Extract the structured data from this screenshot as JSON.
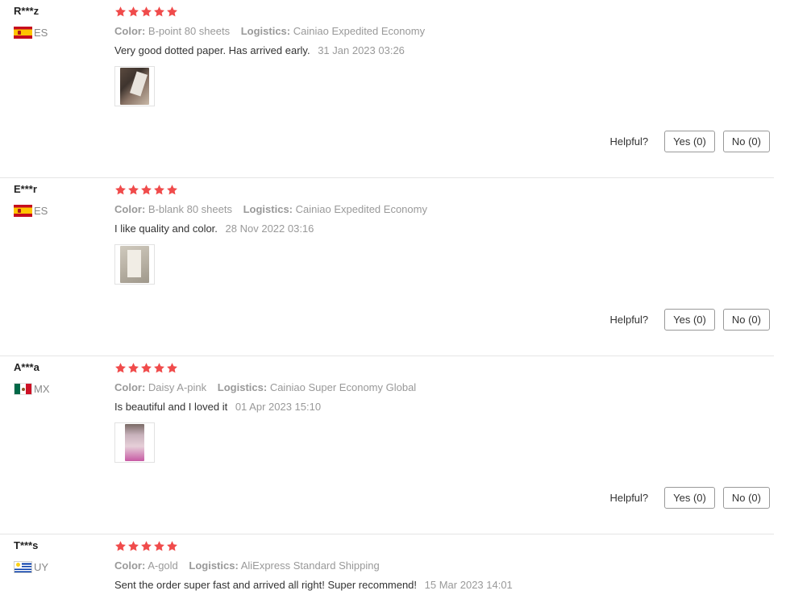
{
  "labels": {
    "color": "Color:",
    "logistics": "Logistics:",
    "helpful": "Helpful?"
  },
  "colors": {
    "star": "#f04b4b"
  },
  "reviews": [
    {
      "user": "R***z",
      "country": "ES",
      "flag_icon": "spain-flag-icon",
      "stars": 5,
      "color": "B-point 80 sheets",
      "logistics": "Cainiao Expedited Economy",
      "text": "Very good dotted paper. Has arrived early.",
      "date": "31 Jan 2023 03:26",
      "yes": "Yes (0)",
      "no": "No (0)"
    },
    {
      "user": "E***r",
      "country": "ES",
      "flag_icon": "spain-flag-icon",
      "stars": 5,
      "color": "B-blank 80 sheets",
      "logistics": "Cainiao Expedited Economy",
      "text": "I like quality and color.",
      "date": "28 Nov 2022 03:16",
      "yes": "Yes (0)",
      "no": "No (0)"
    },
    {
      "user": "A***a",
      "country": "MX",
      "flag_icon": "mexico-flag-icon",
      "stars": 5,
      "color": "Daisy A-pink",
      "logistics": "Cainiao Super Economy Global",
      "text": "Is beautiful and I loved it",
      "date": "01 Apr 2023 15:10",
      "yes": "Yes (0)",
      "no": "No (0)"
    },
    {
      "user": "T***s",
      "country": "UY",
      "flag_icon": "uruguay-flag-icon",
      "stars": 5,
      "color": "A-gold",
      "logistics": "AliExpress Standard Shipping",
      "text": "Sent the order super fast and arrived all right! Super recommend!",
      "date": "15 Mar 2023 14:01"
    }
  ]
}
